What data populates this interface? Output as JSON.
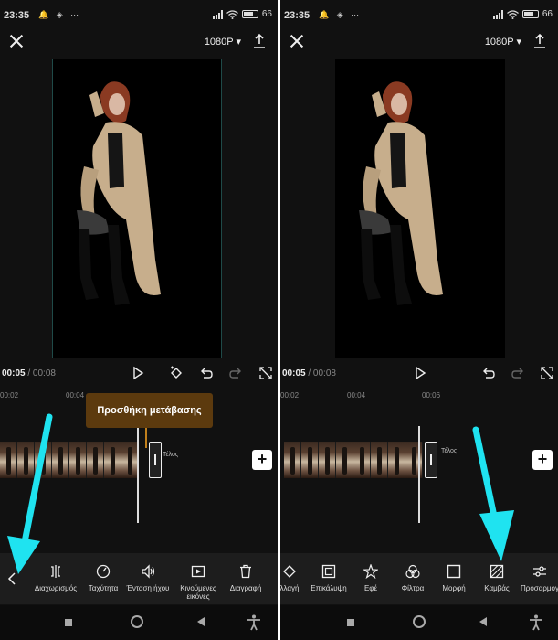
{
  "status_bar": {
    "time": "23:35",
    "battery_text": "66"
  },
  "top_bar": {
    "resolution_label": "1080P ▾"
  },
  "playback": {
    "current_time": "00:05",
    "duration": "00:08",
    "separator": " / "
  },
  "left_panel": {
    "ruler_ticks": [
      "00:02",
      "00:04"
    ],
    "tooltip_text": "Προσθήκη μετάβασης",
    "end_label": "Τέλος",
    "toolbar": [
      {
        "icon": "split-icon",
        "label": "Διαχωρισμός"
      },
      {
        "icon": "speed-icon",
        "label": "Ταχύτητα"
      },
      {
        "icon": "volume-icon",
        "label": "Ένταση ήχου"
      },
      {
        "icon": "animation-icon",
        "label": "Κινούμενες εικόνες"
      },
      {
        "icon": "trash-icon",
        "label": "Διαγραφή"
      }
    ]
  },
  "right_panel": {
    "ruler_ticks": [
      "00:02",
      "00:04",
      "00:06"
    ],
    "end_label": "Τέλος",
    "toolbar": [
      {
        "icon": "replace-icon",
        "label": "λλαγή"
      },
      {
        "icon": "overlay-icon",
        "label": "Επικάλυψη"
      },
      {
        "icon": "effects-icon",
        "label": "Εφέ"
      },
      {
        "icon": "filters-icon",
        "label": "Φίλτρα"
      },
      {
        "icon": "format-icon",
        "label": "Μορφή"
      },
      {
        "icon": "canvas-icon",
        "label": "Καμβάς"
      },
      {
        "icon": "adjust-icon",
        "label": "Προσαρμογ"
      }
    ]
  },
  "colors": {
    "background": "#111111",
    "toolbar": "#1d1d1d",
    "tooltip": "#5c3a0e",
    "annotation_arrow": "#1fe3f0"
  }
}
